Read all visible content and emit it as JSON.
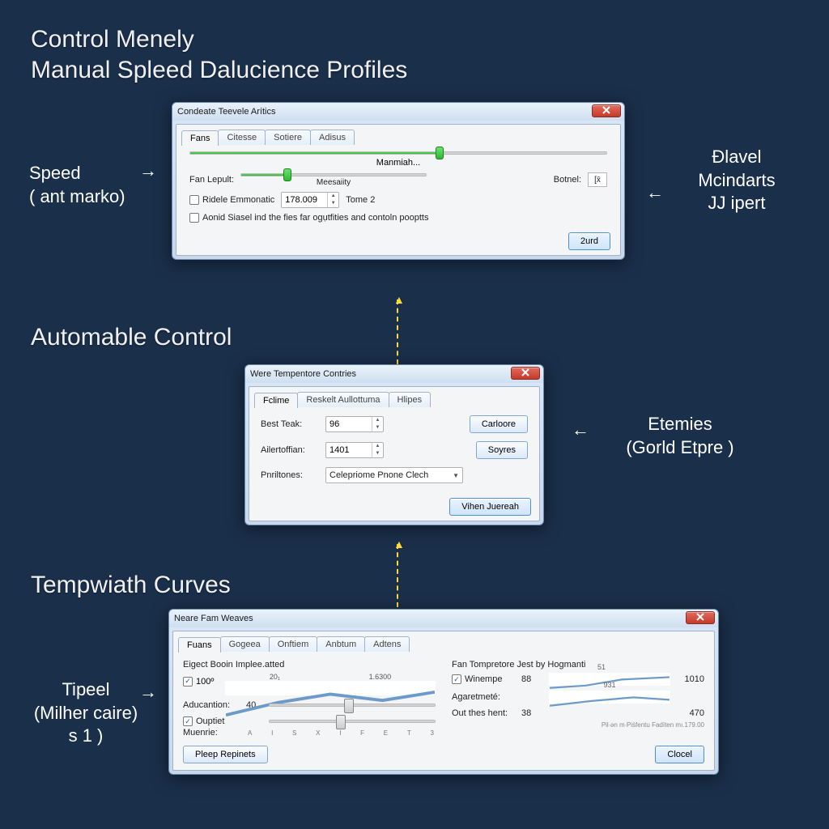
{
  "headings": {
    "h1a": "Control Menely",
    "h1b": "Manual Spleed Dalucience Profiles",
    "h2": "Automable Control",
    "h3": "Tempwiath Curves"
  },
  "side": {
    "left1a": "Speed",
    "left1b": "( ant marko)",
    "right1a": "Đlavel",
    "right1b": "Mcindarts",
    "right1c": "JJ ipert",
    "right2a": "Etemies",
    "right2b": "(Gorld Etpre )",
    "left3a": "Tipeel",
    "left3b": "(Milher caire)",
    "left3c": "s 1 )"
  },
  "win1": {
    "title": "Condeate Teevele Arítics",
    "tabs": [
      "Fans",
      "Citesse",
      "Sotiere",
      "Adisus"
    ],
    "slider1_caption": "Manmiah...",
    "row_label": "Fan Lepult:",
    "row_caption": "Meesaiity",
    "row_right_label": "Botnel:",
    "row_right_val": "[x̄",
    "chk1": "Ridele Emmonatic",
    "spin_val": "178.009",
    "spin_right": "Tome 2",
    "chk2": "Aonid Siasel ind the fies far ogụtfities and contoln pooptts",
    "btn": "2urd"
  },
  "win2": {
    "title": "Were Tempentore Contries",
    "tabs": [
      "Fclime",
      "Reskelt Aullottuma",
      "Hlipes"
    ],
    "r1_label": "Best Teak:",
    "r1_val": "96",
    "r1_btn": "Carloore",
    "r2_label": "Ailertoffian:",
    "r2_val": "1401",
    "r2_btn": "Soyres",
    "r3_label": "Pnriltones:",
    "r3_val": "Celepriome Pnone Clech",
    "footer_btn": "Vihen Juereah"
  },
  "win3": {
    "title": "Neare Fam Weaves",
    "tabs": [
      "Fuans",
      "Gogeea",
      "Onftiem",
      "Anbtum",
      "Adtens"
    ],
    "left_title": "Eigect Booin Implee.atted",
    "left_numA": "100º",
    "left_chart_labels": [
      "20₁",
      "1.6300"
    ],
    "left_l1": "Aducantion:",
    "left_l1_val": "40",
    "left_chk": "Ouptiet",
    "left_l2": "Muenrie:",
    "left_axis": [
      "A",
      "I",
      "S",
      "X",
      "I",
      "F",
      "E",
      "T",
      "3"
    ],
    "right_title": "Fan Tompretore Jest by Hogmanti",
    "right_chk": "Winempe",
    "right_r1a": "88",
    "right_r1b": "51",
    "right_r1c": "1010",
    "right_l2": "Agaretmeté:",
    "right_r2a": "931",
    "right_l3": "Out thes hent:",
    "right_r3a": "38",
    "right_r3b": "470",
    "right_note": "Pil∙ən m∙Piśfentu Fadïten mı.179.00",
    "btn_left": "Pleep Repinets",
    "btn_right": "Clocel"
  }
}
